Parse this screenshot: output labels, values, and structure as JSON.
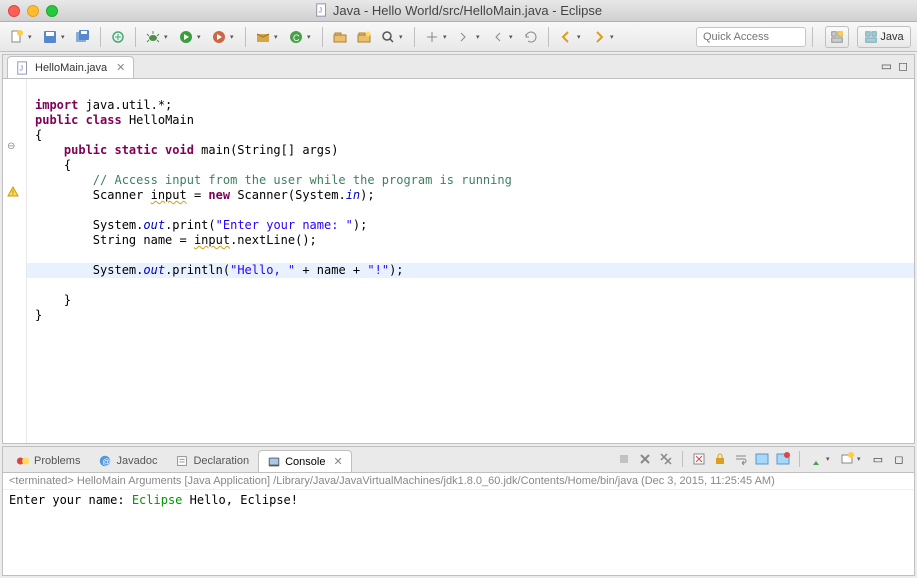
{
  "window": {
    "title": "Java - Hello World/src/HelloMain.java - Eclipse"
  },
  "toolbar": {
    "quick_access_placeholder": "Quick Access",
    "perspective_label": "Java"
  },
  "editor": {
    "tab_label": "HelloMain.java",
    "code": {
      "l1_import": "import",
      "l1_rest": " java.util.*;",
      "l2_public": "public",
      "l2_class": "class",
      "l2_name": " HelloMain",
      "l3": "{",
      "l4_mods": "public static void",
      "l4_sig": " main(String[] args)",
      "l5": "    {",
      "l6_cmt": "// Access input from the user while the program is running",
      "l7a": "        Scanner ",
      "l7_var": "input",
      "l7b": " = ",
      "l7_new": "new",
      "l7c": " Scanner(System.",
      "l7_in": "in",
      "l7d": ");",
      "l9a": "        System.",
      "l9_out": "out",
      "l9b": ".print(",
      "l9_str": "\"Enter your name: \"",
      "l9c": ");",
      "l10a": "        String name = ",
      "l10_var": "input",
      "l10b": ".nextLine();",
      "l12a": "        System.",
      "l12_out": "out",
      "l12b": ".println(",
      "l12_s1": "\"Hello, \"",
      "l12c": " + name + ",
      "l12_s2": "\"!\"",
      "l12d": ");",
      "l13": "    }",
      "l14": "}"
    }
  },
  "bottom": {
    "tabs": {
      "problems": "Problems",
      "javadoc": "Javadoc",
      "declaration": "Declaration",
      "console": "Console"
    },
    "console": {
      "meta": "<terminated> HelloMain Arguments [Java Application] /Library/Java/JavaVirtualMachines/jdk1.8.0_60.jdk/Contents/Home/bin/java (Dec 3, 2015, 11:25:45 AM)",
      "line1_prompt": "Enter your name: ",
      "line1_input": "Eclipse",
      "line2": "Hello, Eclipse!"
    }
  }
}
